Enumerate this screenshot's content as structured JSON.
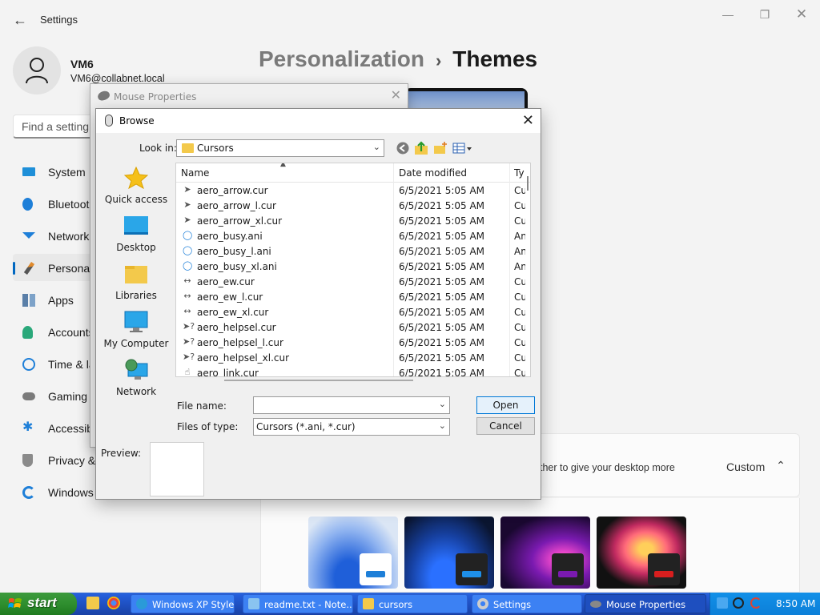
{
  "settings": {
    "title": "Settings",
    "user": {
      "name": "VM6",
      "email": "VM6@collabnet.local"
    },
    "search_placeholder": "Find a setting",
    "nav": [
      {
        "label": "System",
        "icon": "system-icon"
      },
      {
        "label": "Bluetooth & devices",
        "icon": "bluetooth-icon"
      },
      {
        "label": "Network & internet",
        "icon": "network-icon"
      },
      {
        "label": "Personalization",
        "icon": "brush-icon",
        "active": true
      },
      {
        "label": "Apps",
        "icon": "apps-icon"
      },
      {
        "label": "Accounts",
        "icon": "accounts-icon"
      },
      {
        "label": "Time & language",
        "icon": "clock-icon"
      },
      {
        "label": "Gaming",
        "icon": "gamepad-icon"
      },
      {
        "label": "Accessibility",
        "icon": "accessibility-icon"
      },
      {
        "label": "Privacy & security",
        "icon": "shield-icon"
      },
      {
        "label": "Windows Update",
        "icon": "update-icon"
      }
    ],
    "breadcrumb": {
      "parent": "Personalization",
      "current": "Themes"
    },
    "custom_row": {
      "description": "ther to give your desktop more",
      "value": "Custom"
    }
  },
  "mouse_properties": {
    "title": "Mouse Properties"
  },
  "browse": {
    "title": "Browse",
    "look_in_label": "Look in:",
    "look_in_value": "Cursors",
    "places": [
      {
        "label": "Quick access",
        "icon": "star-icon"
      },
      {
        "label": "Desktop",
        "icon": "desktop-icon"
      },
      {
        "label": "Libraries",
        "icon": "libraries-icon"
      },
      {
        "label": "My Computer",
        "icon": "computer-icon"
      },
      {
        "label": "Network",
        "icon": "network-globe-icon"
      }
    ],
    "columns": {
      "name": "Name",
      "date": "Date modified",
      "type": "Ty"
    },
    "files": [
      {
        "name": "aero_arrow.cur",
        "date": "6/5/2021 5:05 AM",
        "type": "Cu",
        "icon": "arrow-cursor-icon"
      },
      {
        "name": "aero_arrow_l.cur",
        "date": "6/5/2021 5:05 AM",
        "type": "Cu",
        "icon": "arrow-cursor-icon"
      },
      {
        "name": "aero_arrow_xl.cur",
        "date": "6/5/2021 5:05 AM",
        "type": "Cu",
        "icon": "arrow-cursor-icon"
      },
      {
        "name": "aero_busy.ani",
        "date": "6/5/2021 5:05 AM",
        "type": "An",
        "icon": "busy-cursor-icon"
      },
      {
        "name": "aero_busy_l.ani",
        "date": "6/5/2021 5:05 AM",
        "type": "An",
        "icon": "busy-cursor-icon"
      },
      {
        "name": "aero_busy_xl.ani",
        "date": "6/5/2021 5:05 AM",
        "type": "An",
        "icon": "busy-cursor-icon"
      },
      {
        "name": "aero_ew.cur",
        "date": "6/5/2021 5:05 AM",
        "type": "Cu",
        "icon": "ew-cursor-icon"
      },
      {
        "name": "aero_ew_l.cur",
        "date": "6/5/2021 5:05 AM",
        "type": "Cu",
        "icon": "ew-cursor-icon"
      },
      {
        "name": "aero_ew_xl.cur",
        "date": "6/5/2021 5:05 AM",
        "type": "Cu",
        "icon": "ew-cursor-icon"
      },
      {
        "name": "aero_helpsel.cur",
        "date": "6/5/2021 5:05 AM",
        "type": "Cu",
        "icon": "helpsel-cursor-icon"
      },
      {
        "name": "aero_helpsel_l.cur",
        "date": "6/5/2021 5:05 AM",
        "type": "Cu",
        "icon": "helpsel-cursor-icon"
      },
      {
        "name": "aero_helpsel_xl.cur",
        "date": "6/5/2021 5:05 AM",
        "type": "Cu",
        "icon": "helpsel-cursor-icon"
      },
      {
        "name": "aero_link.cur",
        "date": "6/5/2021 5:05 AM",
        "type": "Cu",
        "icon": "hand-cursor-icon"
      }
    ],
    "file_name_label": "File name:",
    "file_name_value": "",
    "file_type_label": "Files of type:",
    "file_type_value": "Cursors (*.ani, *.cur)",
    "open_label": "Open",
    "cancel_label": "Cancel",
    "preview_label": "Preview:"
  },
  "taskbar": {
    "start_label": "start",
    "tasks": [
      {
        "label": "Windows XP Style...",
        "icon": "edge-icon"
      },
      {
        "label": "readme.txt - Note...",
        "icon": "notepad-icon"
      },
      {
        "label": "cursors",
        "icon": "folder-icon"
      },
      {
        "label": "Settings",
        "icon": "gear-icon"
      },
      {
        "label": "Mouse Properties",
        "icon": "mouse-icon",
        "active": true
      }
    ],
    "clock": "8:50 AM"
  }
}
